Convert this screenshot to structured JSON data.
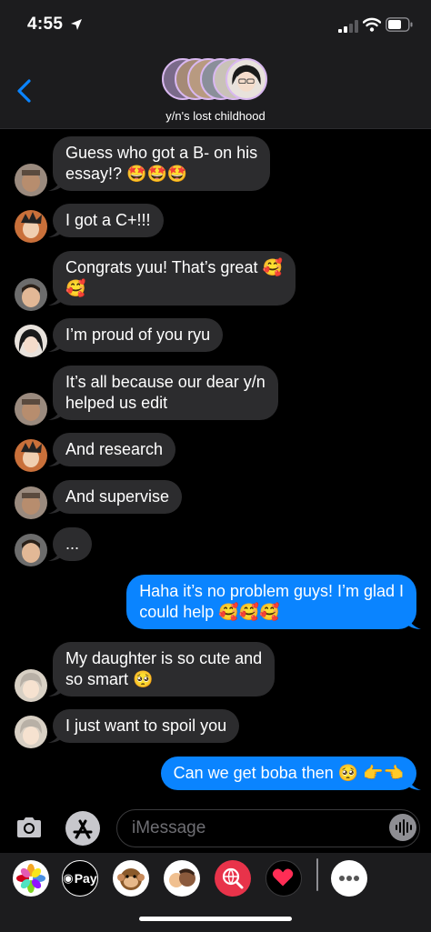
{
  "status_bar": {
    "time": "4:55"
  },
  "header": {
    "group_name": "y/n's lost childhood"
  },
  "messages": [
    {
      "from": "them",
      "avatar": "avatar-ryu",
      "lines": [
        "Guess who got a B- on his",
        "essay!? 🤩🤩🤩"
      ]
    },
    {
      "from": "them",
      "avatar": "avatar-noya",
      "lines": [
        "I got a C+!!!"
      ]
    },
    {
      "from": "them",
      "avatar": "avatar-daichi",
      "lines": [
        "Congrats yuu! That’s great 🥰",
        "🥰"
      ]
    },
    {
      "from": "them",
      "avatar": "avatar-kiyoko",
      "lines": [
        "I’m proud of you ryu"
      ]
    },
    {
      "from": "them",
      "avatar": "avatar-ryu",
      "lines": [
        "It’s all because our dear y/n",
        "helped us edit"
      ]
    },
    {
      "from": "them",
      "avatar": "avatar-noya",
      "lines": [
        "And research"
      ]
    },
    {
      "from": "them",
      "avatar": "avatar-ryu",
      "lines": [
        "And supervise"
      ]
    },
    {
      "from": "them",
      "avatar": "avatar-daichi",
      "lines": [
        "..."
      ]
    },
    {
      "from": "me",
      "lines": [
        "Haha it’s no problem guys! I’m glad I",
        "could help 🥰🥰🥰"
      ]
    },
    {
      "from": "them",
      "avatar": "avatar-suga",
      "lines": [
        "My daughter is so cute and",
        "so smart 🥺"
      ]
    },
    {
      "from": "them",
      "avatar": "avatar-suga",
      "lines": [
        "I just want to spoil you"
      ]
    },
    {
      "from": "me",
      "lines": [
        "Can we get boba then 🥺 👉👈"
      ]
    }
  ],
  "input": {
    "placeholder": "iMessage"
  },
  "drawer": {
    "apps": [
      "photos-icon",
      "apple-pay-icon",
      "animoji-icon",
      "memoji-icon",
      "web-search-icon",
      "digital-touch-icon",
      "more-apps-icon"
    ],
    "apple_pay_label": "Pay"
  },
  "colors": {
    "sent_bubble": "#0a84ff",
    "received_bubble": "#2c2c2e",
    "stack_border": "#d9b8f0"
  }
}
